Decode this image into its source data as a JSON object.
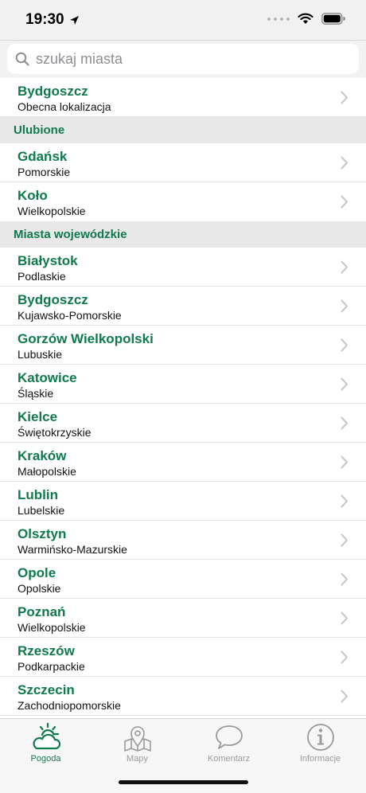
{
  "status": {
    "time": "19:30"
  },
  "search": {
    "placeholder": "szukaj miasta"
  },
  "current_location": {
    "city": "Bydgoszcz",
    "subtitle": "Obecna lokalizacja"
  },
  "favorites": {
    "header": "Ulubione",
    "items": [
      {
        "city": "Gdańsk",
        "region": "Pomorskie"
      },
      {
        "city": "Koło",
        "region": "Wielkopolskie"
      }
    ]
  },
  "voivodeship_cities": {
    "header": "Miasta wojewódzkie",
    "items": [
      {
        "city": "Białystok",
        "region": "Podlaskie"
      },
      {
        "city": "Bydgoszcz",
        "region": "Kujawsko-Pomorskie"
      },
      {
        "city": "Gorzów Wielkopolski",
        "region": "Lubuskie"
      },
      {
        "city": "Katowice",
        "region": "Śląskie"
      },
      {
        "city": "Kielce",
        "region": "Świętokrzyskie"
      },
      {
        "city": "Kraków",
        "region": "Małopolskie"
      },
      {
        "city": "Lublin",
        "region": "Lubelskie"
      },
      {
        "city": "Olsztyn",
        "region": "Warmińsko-Mazurskie"
      },
      {
        "city": "Opole",
        "region": "Opolskie"
      },
      {
        "city": "Poznań",
        "region": "Wielkopolskie"
      },
      {
        "city": "Rzeszów",
        "region": "Podkarpackie"
      },
      {
        "city": "Szczecin",
        "region": "Zachodniopomorskie"
      }
    ]
  },
  "tabs": [
    {
      "label": "Pogoda",
      "icon": "weather-icon",
      "active": true
    },
    {
      "label": "Mapy",
      "icon": "map-icon",
      "active": false
    },
    {
      "label": "Komentarz",
      "icon": "speech-bubble-icon",
      "active": false
    },
    {
      "label": "Informacje",
      "icon": "info-icon",
      "active": false
    }
  ],
  "colors": {
    "accent": "#0f7a4d",
    "inactive": "#9a9a9a",
    "section_bg": "#e8e8e8"
  }
}
